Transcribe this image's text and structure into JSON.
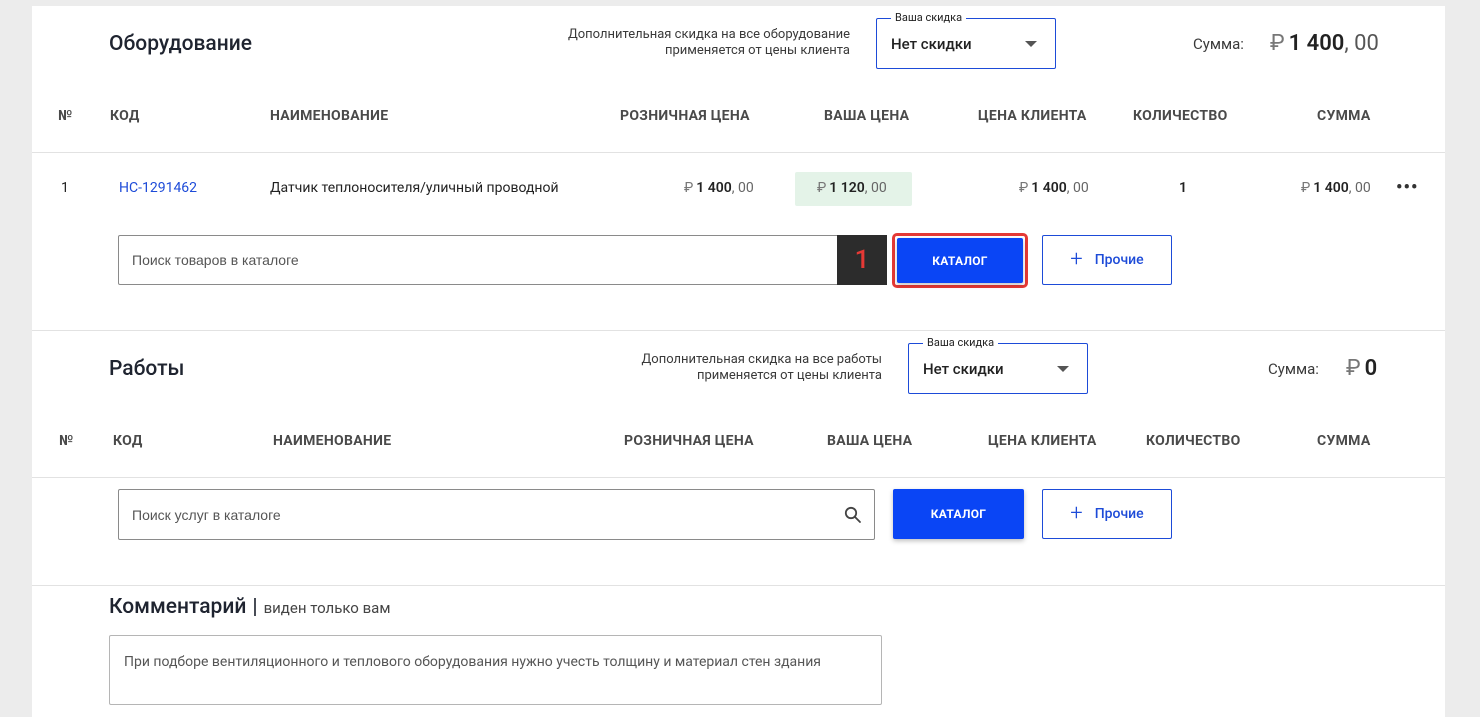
{
  "equipment": {
    "title": "Оборудование",
    "discount_note_line1": "Дополнительная скидка на все оборудование",
    "discount_note_line2": "применяется от цены клиента",
    "discount_label": "Ваша скидка",
    "discount_value": "Нет скидки",
    "sum_label": "Сумма:",
    "sum_currency": "₽",
    "sum_int": "1 400",
    "sum_dec": ", 00",
    "columns": {
      "num": "№",
      "code": "КОД",
      "name": "НАИМЕНОВАНИЕ",
      "retail": "РОЗНИЧНАЯ ЦЕНА",
      "your_price": "ВАША ЦЕНА",
      "client_price": "ЦЕНА КЛИЕНТА",
      "qty": "КОЛИЧЕСТВО",
      "sum": "СУММА"
    },
    "rows": [
      {
        "num": "1",
        "code": "HC-1291462",
        "name": "Датчик теплоносителя/уличный проводной",
        "currency": "₽",
        "retail_int": "1 400",
        "retail_dec": ", 00",
        "your_int": "1 120",
        "your_dec": ", 00",
        "client_int": "1 400",
        "client_dec": ", 00",
        "qty": "1",
        "sum_int": "1 400",
        "sum_dec": ", 00",
        "more": "•••"
      }
    ],
    "search_placeholder": "Поиск товаров в каталоге",
    "catalog_button": "КАТАЛОГ",
    "other_button": "Прочие",
    "other_plus": "+",
    "step_marker": "1"
  },
  "works": {
    "title": "Работы",
    "discount_note_line1": "Дополнительная скидка на все работы",
    "discount_note_line2": "применяется от цены клиента",
    "discount_label": "Ваша скидка",
    "discount_value": "Нет скидки",
    "sum_label": "Сумма:",
    "sum_currency": "₽",
    "sum_int": "0",
    "columns": {
      "num": "№",
      "code": "КОД",
      "name": "НАИМЕНОВАНИЕ",
      "retail": "РОЗНИЧНАЯ ЦЕНА",
      "your_price": "ВАША ЦЕНА",
      "client_price": "ЦЕНА КЛИЕНТА",
      "qty": "КОЛИЧЕСТВО",
      "sum": "СУММА"
    },
    "search_placeholder": "Поиск услуг в каталоге",
    "catalog_button": "КАТАЛОГ",
    "other_button": "Прочие",
    "other_plus": "+"
  },
  "comment": {
    "title": "Комментарий",
    "separator": "|",
    "subtitle": "виден только вам",
    "text": "При подборе вентиляционного и теплового оборудования нужно учесть толщину и материал стен здания"
  },
  "colors": {
    "accent": "#0a45f5",
    "highlight": "#e53935",
    "badge": "#e4f3e8"
  }
}
